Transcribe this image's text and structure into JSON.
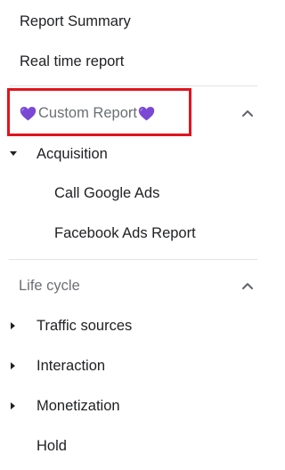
{
  "nav": {
    "items_top": [
      {
        "label": "Report Summary"
      },
      {
        "label": "Real time report"
      }
    ],
    "custom_section": {
      "title": "Custom Report",
      "expanded_icon": "chevron-up-icon",
      "groups": [
        {
          "label": "Acquisition",
          "expanded": true,
          "children": [
            {
              "label": "Call Google Ads"
            },
            {
              "label": "Facebook Ads Report"
            }
          ]
        }
      ]
    },
    "lifecycle_section": {
      "title": "Life cycle",
      "expanded_icon": "chevron-up-icon",
      "groups": [
        {
          "label": "Traffic sources",
          "expanded": false
        },
        {
          "label": "Interaction",
          "expanded": false
        },
        {
          "label": "Monetization",
          "expanded": false
        },
        {
          "label": "Hold",
          "expanded": false
        }
      ]
    }
  },
  "colors": {
    "highlight_border": "#e0141e",
    "heart": "#7b48d6",
    "text": "#202124",
    "muted_text": "#6b6f73",
    "divider": "#e3e3e3"
  }
}
